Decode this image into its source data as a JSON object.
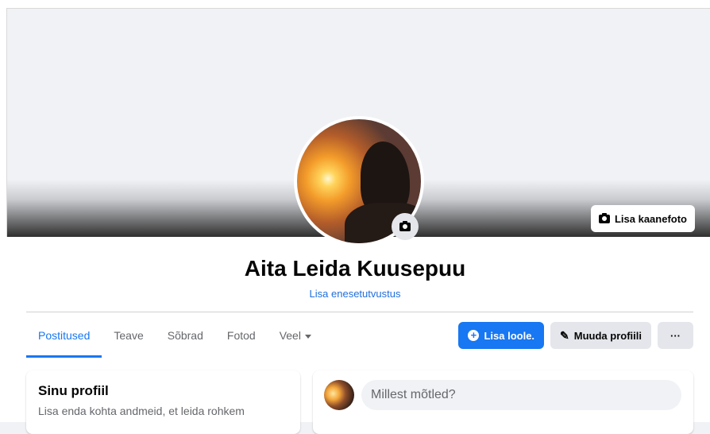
{
  "cover": {
    "add_cover_label": "Lisa kaanefoto"
  },
  "profile": {
    "name": "Aita Leida Kuusepuu",
    "bio_link": "Lisa enesetutvustus"
  },
  "tabs": [
    {
      "label": "Postitused",
      "active": true
    },
    {
      "label": "Teave",
      "active": false
    },
    {
      "label": "Sõbrad",
      "active": false
    },
    {
      "label": "Fotod",
      "active": false
    },
    {
      "label": "Veel",
      "active": false
    }
  ],
  "actions": {
    "add_story": "Lisa loole.",
    "edit_profile": "Muuda profiili",
    "more": "···"
  },
  "intro_card": {
    "title": "Sinu profiil",
    "text": "Lisa enda kohta andmeid, et leida rohkem"
  },
  "composer": {
    "placeholder": "Millest mõtled?"
  },
  "colors": {
    "accent": "#1877f2",
    "link": "#216fdb"
  }
}
